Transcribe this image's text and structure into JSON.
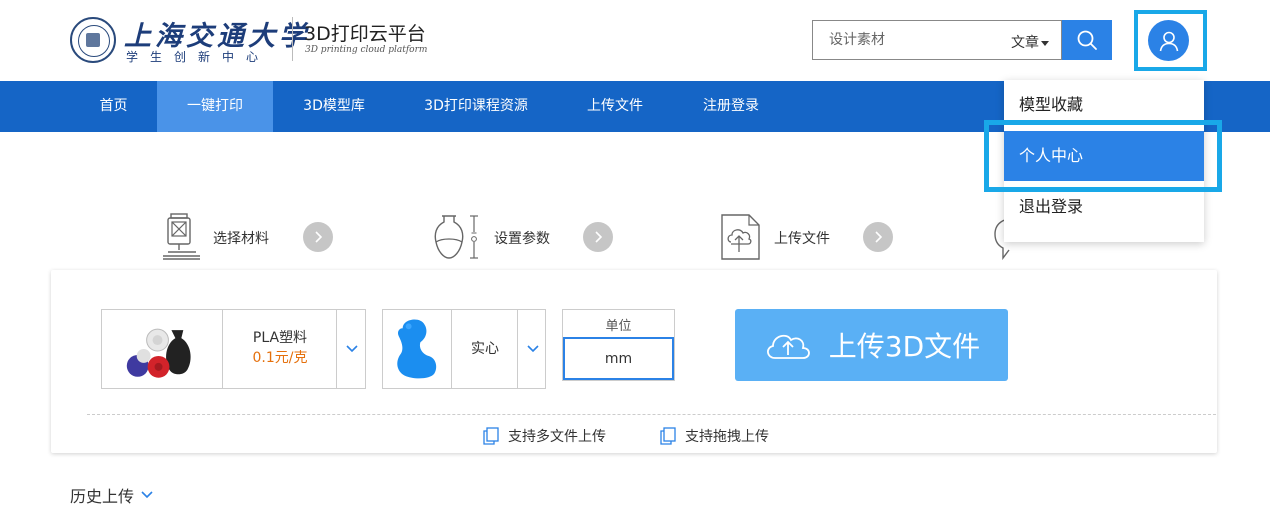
{
  "header": {
    "logo_name": "上海交通大学",
    "logo_sub": "学生创新中心",
    "platform_title": "3D打印云平台",
    "platform_en": "3D printing cloud platform"
  },
  "search": {
    "placeholder": "设计素材",
    "type_label": "文章"
  },
  "nav": {
    "items": [
      {
        "label": "首页"
      },
      {
        "label": "一键打印"
      },
      {
        "label": "3D模型库"
      },
      {
        "label": "3D打印课程资源"
      },
      {
        "label": "上传文件"
      },
      {
        "label": "注册登录"
      }
    ],
    "active_index": 1
  },
  "user_menu": {
    "items": [
      {
        "label": "模型收藏"
      },
      {
        "label": "个人中心"
      },
      {
        "label": "退出登录"
      }
    ],
    "active_index": 1
  },
  "steps": [
    {
      "label": "选择材料",
      "icon": "printer-icon"
    },
    {
      "label": "设置参数",
      "icon": "vase-dimension-icon"
    },
    {
      "label": "上传文件",
      "icon": "cloud-upload-file-icon"
    },
    {
      "label": "",
      "icon": "chat-icon"
    }
  ],
  "order_form": {
    "material": {
      "name": "PLA塑料",
      "price": "0.1元/克"
    },
    "fill": {
      "name": "实心"
    },
    "unit": {
      "label": "单位",
      "value": "mm"
    },
    "upload_label": "上传3D文件",
    "features": [
      {
        "label": "支持多文件上传"
      },
      {
        "label": "支持拖拽上传"
      }
    ]
  },
  "history": {
    "label": "历史上传"
  },
  "colors": {
    "nav_bg": "#1565c6",
    "nav_active": "#4a93e8",
    "accent": "#2b82e6",
    "highlight": "#19a8e8",
    "upload_btn": "#5ab0f5",
    "price": "#e5700c"
  }
}
